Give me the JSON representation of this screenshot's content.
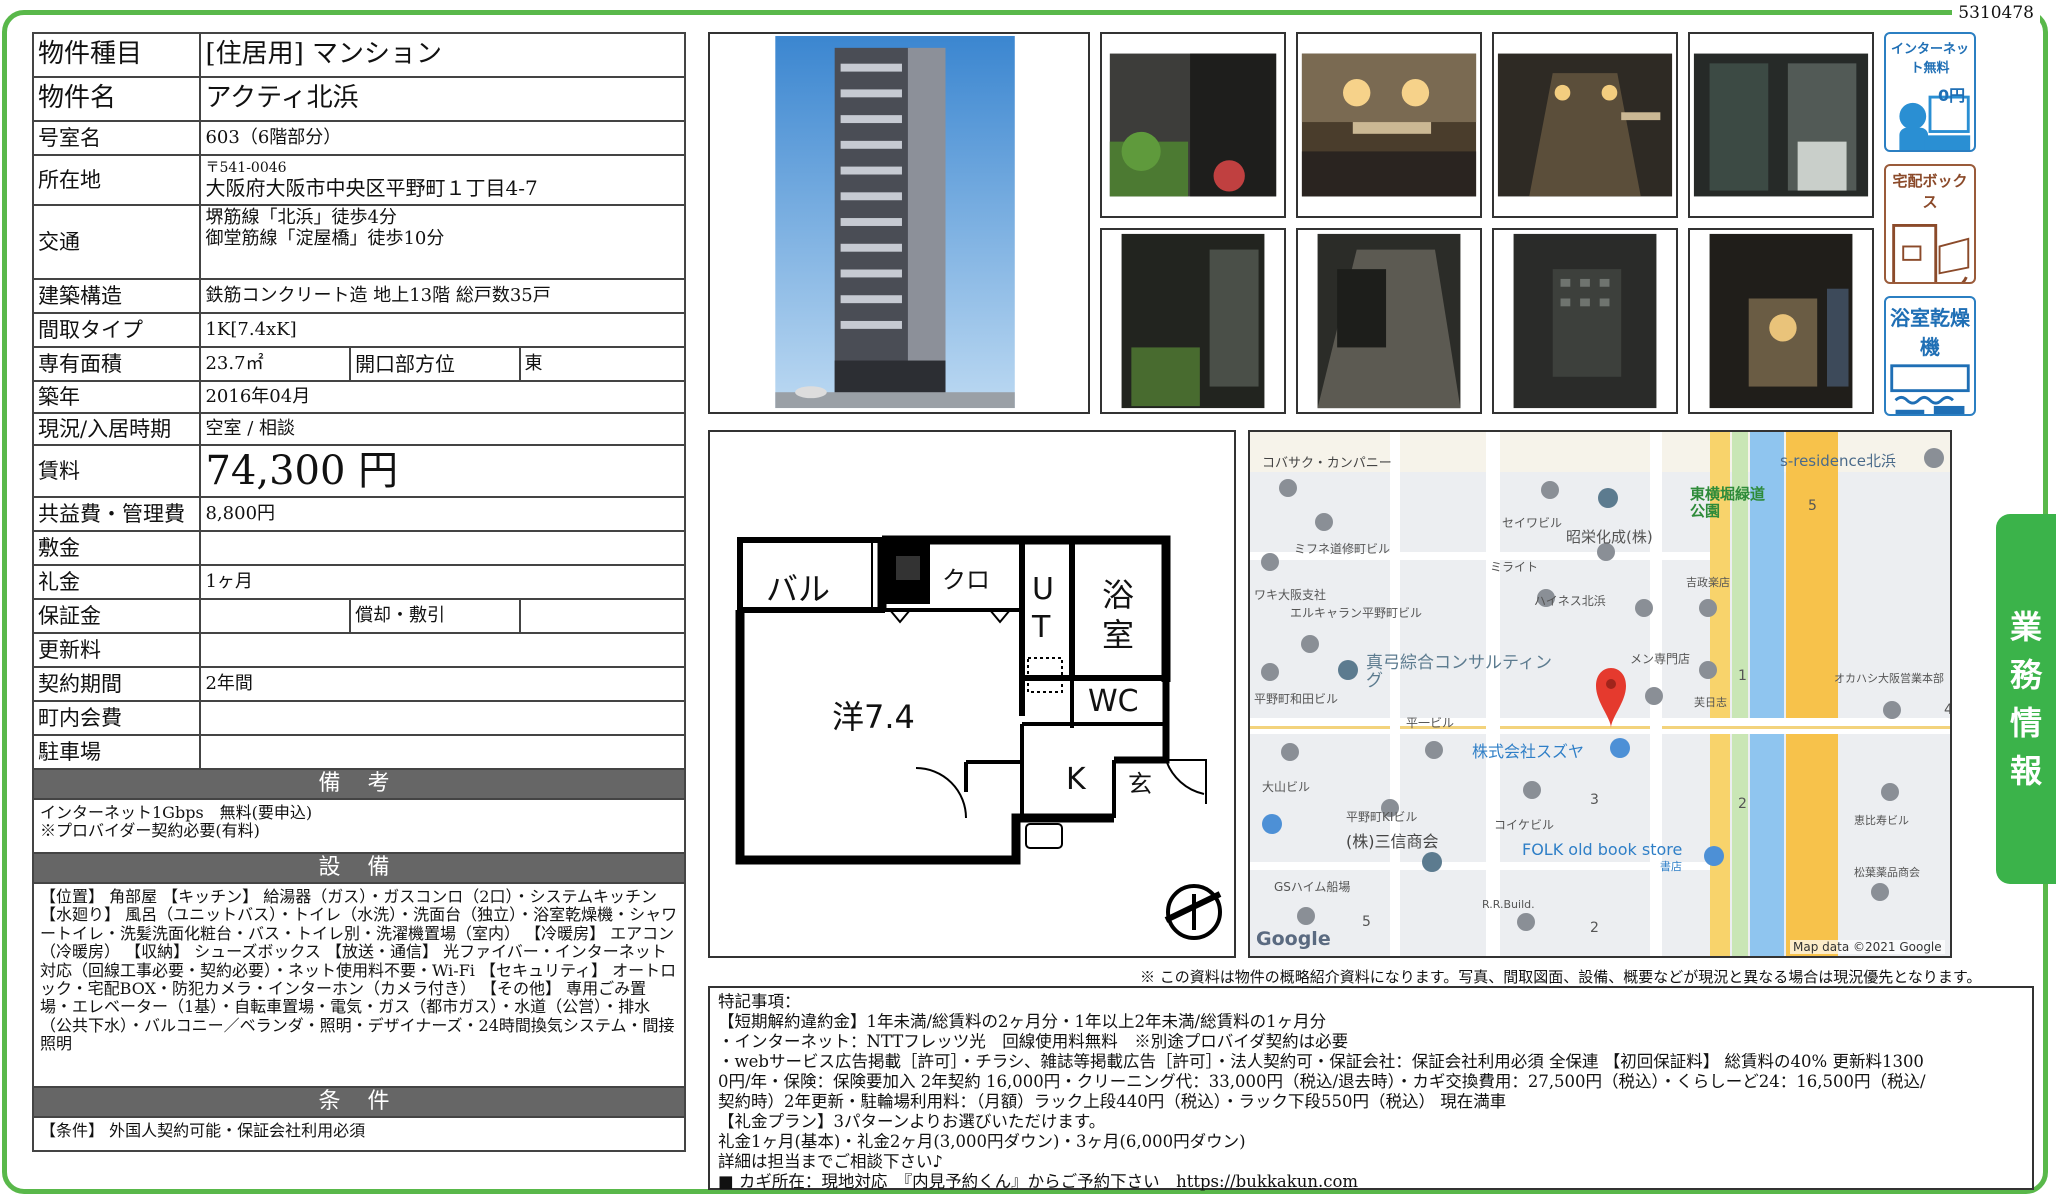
{
  "doc_number": "5310478",
  "property": {
    "type_label": "物件種目",
    "type_value": "[住居用] マンション",
    "name_label": "物件名",
    "name_value": "アクティ北浜",
    "room_label": "号室名",
    "room_value": "603（6階部分）",
    "address_label": "所在地",
    "postal": "〒541-0046",
    "address": "大阪府大阪市中央区平野町１丁目4-7",
    "transport_label": "交通",
    "transport_1": "堺筋線「北浜」徒歩4分",
    "transport_2": "御堂筋線「淀屋橋」徒歩10分",
    "structure_label": "建築構造",
    "structure_value": "鉄筋コンクリート造 地上13階 総戸数35戸",
    "layout_label": "間取タイプ",
    "layout_value": "1K[7.4xK]",
    "area_label": "専有面積",
    "area_value": "23.7㎡",
    "opening_label": "開口部方位",
    "opening_value": "東",
    "built_label": "築年",
    "built_value": "2016年04月",
    "status_label": "現況/入居時期",
    "status_value": "空室 / 相談",
    "rent_label": "賃料",
    "rent_value": "74,300 円",
    "fee_label": "共益費・管理費",
    "fee_value": "8,800円",
    "deposit_label": "敷金",
    "deposit_value": "",
    "key_money_label": "礼金",
    "key_money_value": "1ヶ月",
    "guarantee_label": "保証金",
    "guarantee_value": "",
    "amort_label": "償却・敷引",
    "amort_value": "",
    "renewal_label": "更新料",
    "renewal_value": "",
    "contract_label": "契約期間",
    "contract_value": "2年間",
    "town_fee_label": "町内会費",
    "town_fee_value": "",
    "parking_label": "駐車場",
    "parking_value": ""
  },
  "remarks": {
    "heading": "備 考",
    "line1": "インターネット1Gbps　無料(要申込)",
    "line2": "※プロバイダー契約必要(有料)"
  },
  "facilities": {
    "heading": "設 備",
    "text": "【位置】 角部屋 【キッチン】 給湯器（ガス）・ガスコンロ（2口）・システムキッチン 【水廻り】 風呂（ユニットバス）・トイレ（水洗）・洗面台（独立）・浴室乾燥機・シャワートイレ・洗髪洗面化粧台・バス・トイレ別・洗濯機置場（室内） 【冷暖房】 エアコン（冷暖房） 【収納】 シューズボックス 【放送・通信】 光ファイバー・インターネット対応（回線工事必要・契約必要）・ネット使用料不要・Wi-Fi 【セキュリティ】 オートロック・宅配BOX・防犯カメラ・インターホン（カメラ付き） 【その他】 専用ごみ置場・エレベーター（1基）・自転車置場・電気・ガス（都市ガス）・水道（公営）・排水（公共下水）・バルコニー／ベランダ・照明・デザイナーズ・24時間換気システム・間接照明"
  },
  "conditions": {
    "heading": "条 件",
    "text": "【条件】 外国人契約可能・保証会社利用必須"
  },
  "floorplan": {
    "balcony": "バル",
    "closet": "クロ",
    "ut_u": "U",
    "ut_t": "T",
    "bath_1": "浴",
    "bath_2": "室",
    "room": "洋7.4",
    "wc": "WC",
    "kitchen": "K",
    "entrance": "玄"
  },
  "map": {
    "labels": [
      "コバサク・カンパニー",
      "s-residence北浜",
      "東横堀緑道公園",
      "セイワビル",
      "昭栄化成(株)",
      "ミフネ道修町ビル",
      "ミライト",
      "吉政楽店",
      "ワキ大阪支社",
      "エルキャラン平野町ビル",
      "ハイネス北浜",
      "真弓綜合コンサルティング",
      "メン専門店",
      "オカハシ大阪営業本部",
      "平野町和田ビル",
      "平一ビル",
      "芙日志",
      "株式会社スズヤ",
      "大山ビル",
      "平野町KIビル",
      "コイケビル",
      "恵比寿ビル",
      "(株)三信商会",
      "FOLK old book store",
      "書店",
      "松葉薬品商会",
      "GSハイム船場",
      "R.R.Build.",
      "Google",
      "Map data ©2021 Google",
      "5",
      "1",
      "2",
      "3",
      "5",
      "2",
      "4"
    ]
  },
  "disclaimer": "※ この資料は物件の概略紹介資料になります。写真、間取図面、設備、概要などが現況と異なる場合は現況優先となります。",
  "notes": {
    "lines": [
      "特記事項：",
      "【短期解約違約金】1年未満/総賃料の2ヶ月分・1年以上2年未満/総賃料の1ヶ月分",
      "・インターネット：NTTフレッツ光　回線使用料無料　※別途プロバイダ契約は必要",
      "・webサービス広告掲載［許可］・チラシ、雑誌等掲載広告［許可］・法人契約可・保証会社：保証会社利用必須 全保連 【初回保証料】 総賃料の40% 更新料1300",
      "0円/年・保険：保険要加入 2年契約 16,000円・クリーニング代：33,000円（税込/退去時）・カギ交換費用：27,500円（税込）・くらしーど24：16,500円（税込/",
      "契約時）2年更新・駐輪場利用料：（月額）ラック上段440円（税込）・ラック下段550円（税込） 現在満車",
      "【礼金プラン】3パターンよりお選びいただけます。",
      "礼金1ヶ月(基本)・礼金2ヶ月(3,000円ダウン)・3ヶ月(6,000円ダウン)",
      "詳細は担当までご相談下さい♪",
      "■ カギ所在：現地対応　『内見予約くん』からご予約下さい　https://bukkakun.com"
    ]
  },
  "side_tab": [
    "業",
    "務",
    "情",
    "報"
  ],
  "icons": {
    "internet": "インターネット無料",
    "internet_price": "0円",
    "delivery": "宅配ボックス",
    "dryer": "浴室乾燥機"
  },
  "colors": {
    "frame": "#59b84a",
    "tab": "#3bb34a",
    "icon_blue": "#1f6fb5"
  }
}
